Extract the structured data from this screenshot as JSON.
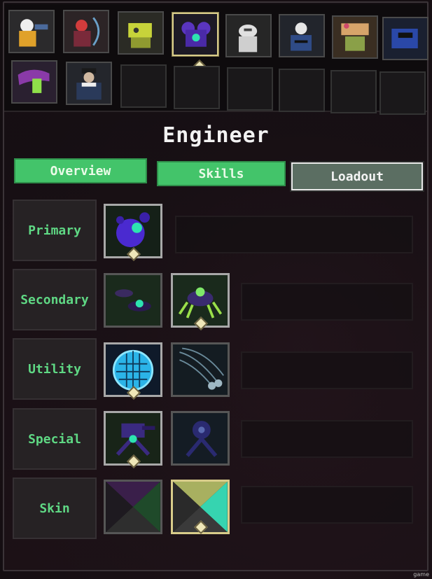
{
  "character": {
    "name": "Engineer"
  },
  "roster": {
    "survivors": [
      {
        "name": "Commando",
        "icon": "commando-portrait-icon"
      },
      {
        "name": "Huntress",
        "icon": "huntress-portrait-icon"
      },
      {
        "name": "MUL-T",
        "icon": "mult-portrait-icon"
      },
      {
        "name": "Engineer",
        "icon": "engineer-portrait-icon",
        "selected": true
      },
      {
        "name": "Artificer",
        "icon": "artificer-portrait-icon"
      },
      {
        "name": "Mercenary",
        "icon": "mercenary-portrait-icon"
      },
      {
        "name": "REX",
        "icon": "rex-portrait-icon"
      },
      {
        "name": "Loader",
        "icon": "loader-portrait-icon"
      },
      {
        "name": "Acrid",
        "icon": "acrid-portrait-icon"
      },
      {
        "name": "Captain",
        "icon": "captain-portrait-icon"
      }
    ],
    "empty_slots": 6
  },
  "tabs": {
    "overview": "Overview",
    "skills": "Skills",
    "loadout": "Loadout"
  },
  "loadout_rows": [
    {
      "label": "Primary",
      "skills": [
        "bouncing-grenades-icon"
      ]
    },
    {
      "label": "Secondary",
      "skills": [
        "pressure-mines-icon",
        "spider-mines-icon"
      ]
    },
    {
      "label": "Utility",
      "skills": [
        "bubble-shield-icon",
        "thermal-harpoons-icon"
      ]
    },
    {
      "label": "Special",
      "skills": [
        "tr12-gauss-auto-turret-icon",
        "tr58-carbonizer-turret-icon"
      ]
    },
    {
      "label": "Skin",
      "skills": [
        "default-skin-icon",
        "eod-tech-skin-icon"
      ]
    }
  ],
  "colors": {
    "accent_green": "#43c46a",
    "label_green": "#5fd884",
    "selected_gold": "#d8cc8a"
  },
  "watermark": "game"
}
